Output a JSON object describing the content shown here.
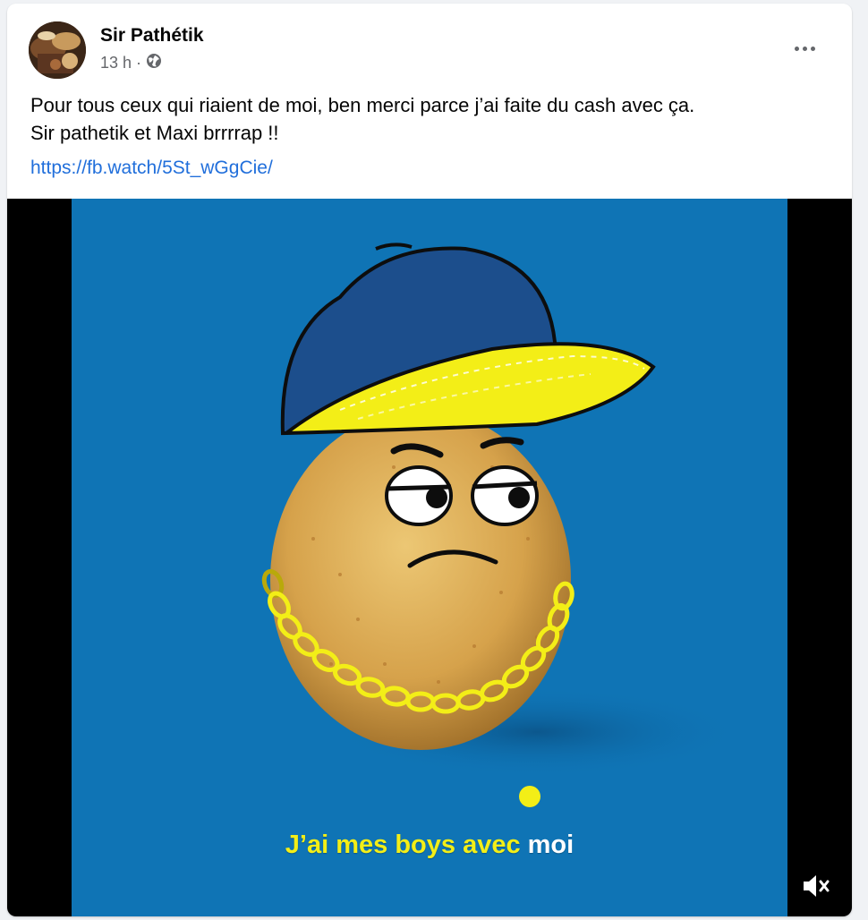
{
  "post": {
    "author": "Sir Pathétik",
    "time": "13 h",
    "separator": "·",
    "text_line1": "Pour tous ceux qui riaient de moi, ben merci parce j’ai faite du cash avec ça.",
    "text_line2": "Sir pathetik et Maxi brrrrap !!",
    "link": "https://fb.watch/5St_wGgCie/"
  },
  "video": {
    "caption_part1": "J’ai mes boys avec ",
    "caption_part2": "moi",
    "background_color": "#0f74b5",
    "caption_color": "#f3ee17",
    "mute_icon": "speaker-muted-icon"
  },
  "icons": {
    "privacy": "globe-icon",
    "options": "more-options-icon"
  },
  "colors": {
    "link": "#216fdb",
    "meta": "#65676b"
  }
}
